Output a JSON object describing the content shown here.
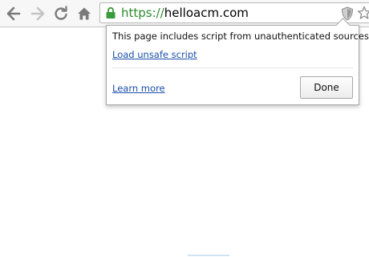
{
  "toolbar": {
    "back_icon": "back-arrow-icon",
    "forward_icon": "forward-arrow-icon",
    "reload_icon": "reload-icon",
    "home_icon": "home-icon"
  },
  "omnibox": {
    "lock_icon": "lock-icon",
    "url_scheme": "https://",
    "url_host": "helloacm.com",
    "shield_icon": "shield-icon",
    "star_icon": "star-icon"
  },
  "mixed_content_popup": {
    "message": "This page includes script from unauthenticated sources.",
    "load_unsafe_label": "Load unsafe script",
    "learn_more_label": "Learn more",
    "done_label": "Done"
  },
  "colors": {
    "secure_green": "#2d8c2d",
    "link_blue": "#1a4fa8"
  }
}
